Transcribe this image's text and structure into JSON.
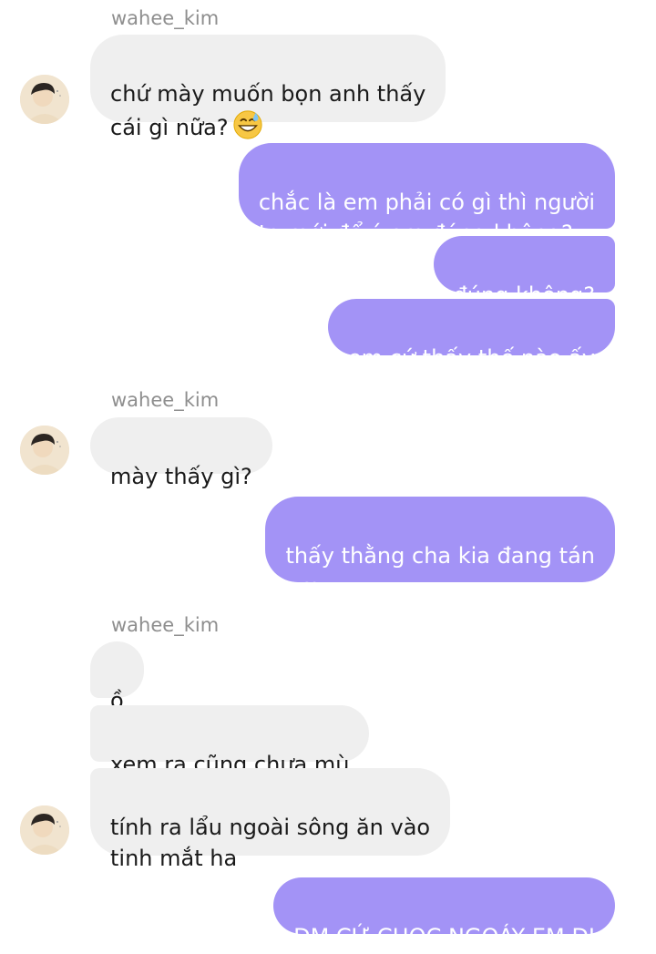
{
  "conversation": {
    "sender_name": "wahee_kim",
    "messages": [
      {
        "from": "wahee_kim",
        "text": "chứ mày muốn bọn anh thấy\ncái gì nữa?",
        "emoji": "grinning-sweat-emoji"
      },
      {
        "from": "me",
        "text": "chắc là em phải có gì thì người\nta mới để ý em đúng không?"
      },
      {
        "from": "me",
        "text": "đúng không?"
      },
      {
        "from": "me",
        "text": "em cứ thấy thế nào ấy"
      },
      {
        "from": "wahee_kim",
        "text": "mày thấy gì?"
      },
      {
        "from": "me",
        "text": "thấy thằng cha kia đang tán\nem"
      },
      {
        "from": "wahee_kim",
        "text": "ồ"
      },
      {
        "from": "wahee_kim",
        "text": "xem ra cũng chưa mù"
      },
      {
        "from": "wahee_kim",
        "text": "tính ra lẩu ngoài sông ăn vào\ntinh mắt ha"
      },
      {
        "from": "me",
        "text": "ĐM CỨ CHỌC NGOÁY EM ĐI"
      }
    ]
  },
  "colors": {
    "incoming_bubble": "#efefef",
    "outgoing_bubble": "#a393f6",
    "username_text": "#8e8e8e"
  }
}
